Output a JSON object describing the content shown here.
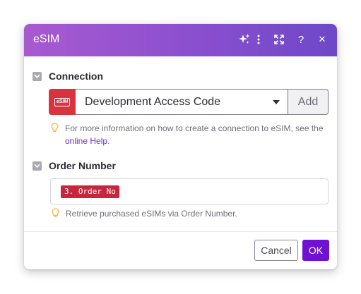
{
  "dialog": {
    "title": "eSIM",
    "header_icons": [
      "sparkle-icon",
      "more-vertical-icon",
      "expand-icon",
      "help-icon",
      "close-icon"
    ],
    "help_glyph": "?",
    "close_glyph": "✕"
  },
  "connection": {
    "label": "Connection",
    "logo_text": "eSIM",
    "selected": "Development Access Code",
    "add_label": "Add",
    "hint_text": "For more information on how to create a connection to eSIM, see the ",
    "hint_link": "online Help",
    "hint_end": "."
  },
  "order": {
    "label": "Order Number",
    "pill": "3. Order No",
    "hint": "Retrieve purchased eSIMs via Order Number."
  },
  "footer": {
    "cancel_label": "Cancel",
    "ok_label": "OK"
  },
  "colors": {
    "header_start": "#a85ad0",
    "header_end": "#6d48c8",
    "accent": "#6f12d6",
    "pill": "#c8243c",
    "logo": "#d8333f",
    "link": "#6f2bd0"
  }
}
